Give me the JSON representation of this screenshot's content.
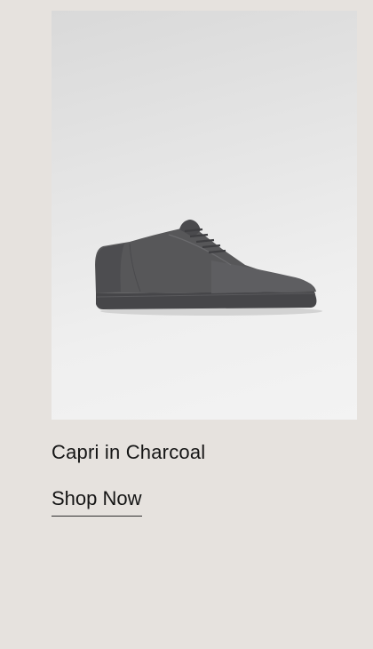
{
  "product": {
    "title": "Capri in Charcoal",
    "image_icon": "sneaker-image",
    "cta_label": "Shop Now"
  },
  "colors": {
    "page_background": "#e6e2de",
    "image_background": "#ececec",
    "text": "#151515",
    "sneaker": "#4f4f52"
  }
}
